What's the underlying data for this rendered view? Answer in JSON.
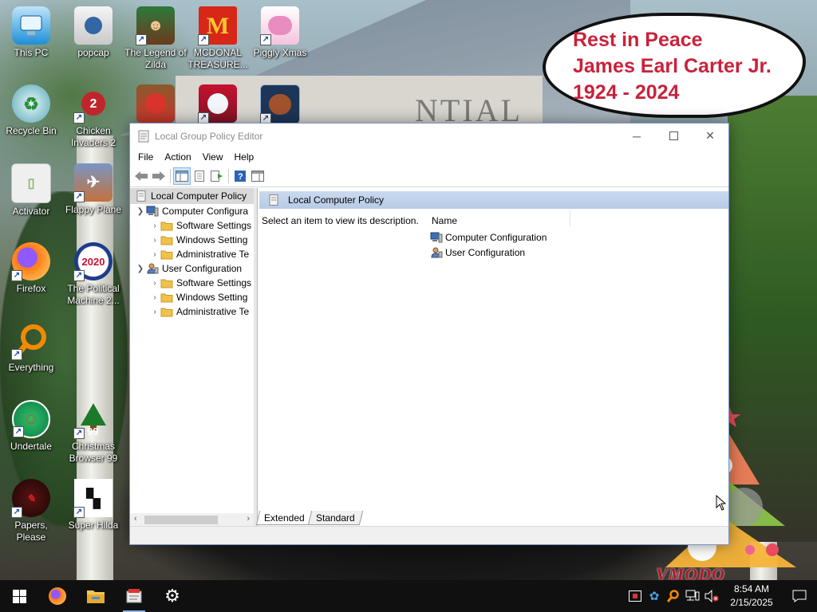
{
  "memorial": {
    "line1": "Rest in Peace",
    "line2": "James Earl Carter Jr.",
    "line3": "1924 - 2024"
  },
  "wallpaper": {
    "wall_text": "NTIAL",
    "watermark": "VMODO"
  },
  "desktop_icons": [
    {
      "label": "This PC",
      "icon": "computer-icon",
      "color": "#1e8fd6",
      "shortcut": false
    },
    {
      "label": "popcap",
      "icon": "folder-app-icon",
      "color": "#3465a4",
      "shortcut": false
    },
    {
      "label": "The Legend of Zilda",
      "icon": "game-character-icon",
      "color": "#2c7a3b",
      "shortcut": true
    },
    {
      "label": "MCDONAL TREASURE...",
      "icon": "golden-arches-icon",
      "color": "#d62718",
      "shortcut": true
    },
    {
      "label": "Piggly Xmas",
      "icon": "pig-icon",
      "color": "#e98cc0",
      "shortcut": true
    },
    {
      "label": "Recycle Bin",
      "icon": "recycle-bin-icon",
      "color": "#5aa7b7",
      "shortcut": false
    },
    {
      "label": "Chicken Invaders 2",
      "icon": "chicken-icon",
      "color": "#c0252b",
      "shortcut": true
    },
    {
      "label": "Activator",
      "icon": "document-icon",
      "color": "#e6e6e6",
      "shortcut": false
    },
    {
      "label": "Flappy Plane",
      "icon": "plane-icon",
      "color": "#6a86b8",
      "shortcut": true
    },
    {
      "label": "Firefox",
      "icon": "firefox-icon",
      "color": "#ff7a1a",
      "shortcut": true
    },
    {
      "label": "The Political Machine 2...",
      "icon": "political-machine-icon",
      "color": "#1e3b8c",
      "shortcut": true
    },
    {
      "label": "Everything",
      "icon": "magnifier-icon",
      "color": "#f28a00",
      "shortcut": true
    },
    {
      "label": "Undertale",
      "icon": "undertale-icon",
      "color": "#0c7c43",
      "shortcut": true
    },
    {
      "label": "Christmas Browser 99",
      "icon": "christmas-tree-icon",
      "color": "#1b7a2a",
      "shortcut": true
    },
    {
      "label": "Papers, Please",
      "icon": "papers-please-icon",
      "color": "#2a0f0f",
      "shortcut": true
    },
    {
      "label": "Super Hilda",
      "icon": "pixel-dog-icon",
      "color": "#ffffff",
      "shortcut": true
    }
  ],
  "partial_icons": [
    {
      "label": "",
      "icon": "seasons-game-icon"
    },
    {
      "label": "",
      "icon": "snowman-icon"
    },
    {
      "label": "",
      "icon": "teddy-bear-icon"
    }
  ],
  "window": {
    "title": "Local Group Policy Editor",
    "menu": [
      "File",
      "Action",
      "View",
      "Help"
    ],
    "tree": {
      "root": "Local Computer Policy",
      "nodes": [
        {
          "label": "Computer Configura",
          "level": 1,
          "expanded": true,
          "icon": "computer-config-icon"
        },
        {
          "label": "Software Settings",
          "level": 2,
          "expanded": false,
          "icon": "folder-icon"
        },
        {
          "label": "Windows Setting",
          "level": 2,
          "expanded": false,
          "icon": "folder-icon"
        },
        {
          "label": "Administrative Te",
          "level": 2,
          "expanded": false,
          "icon": "folder-icon"
        },
        {
          "label": "User Configuration",
          "level": 1,
          "expanded": true,
          "icon": "user-config-icon"
        },
        {
          "label": "Software Settings",
          "level": 2,
          "expanded": false,
          "icon": "folder-icon"
        },
        {
          "label": "Windows Setting",
          "level": 2,
          "expanded": false,
          "icon": "folder-icon"
        },
        {
          "label": "Administrative Te",
          "level": 2,
          "expanded": false,
          "icon": "folder-icon"
        }
      ]
    },
    "detail": {
      "header": "Local Computer Policy",
      "description": "Select an item to view its description.",
      "column_name": "Name",
      "items": [
        "Computer Configuration",
        "User Configuration"
      ]
    },
    "tabs": [
      "Extended",
      "Standard"
    ]
  },
  "taskbar": {
    "clock_time": "8:54 AM",
    "clock_date": "2/15/2025"
  }
}
